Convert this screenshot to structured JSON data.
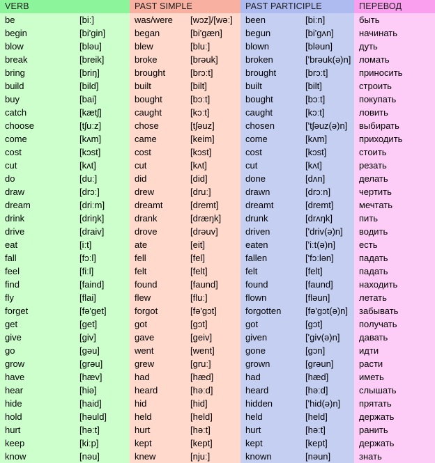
{
  "table": {
    "headers": {
      "verb": "VERB",
      "past_simple": "PAST SIMPLE",
      "past_participle": "PAST PARTICIPLE",
      "translation": "ПЕРЕВОД"
    },
    "colors": {
      "verb_header_bg": "#8cf59b",
      "past_simple_header_bg": "#f8b0a0",
      "past_participle_header_bg": "#aebbf0",
      "translation_header_bg": "#f99fee",
      "verb_bg": "#ccffcc",
      "past_simple_bg": "#ffd9cc",
      "past_participle_bg": "#c5cff2",
      "translation_bg": "#fdcdf7",
      "text": "#000000"
    },
    "rows": [
      {
        "verb": "be",
        "verb_tr": "[biː]",
        "ps": "was/were",
        "ps_tr": "[wɔz]/[wəː]",
        "pp": "been",
        "pp_tr": "[biːn]",
        "ru": "быть"
      },
      {
        "verb": "begin",
        "verb_tr": "[bi'gin]",
        "ps": "began",
        "ps_tr": "[bi'gæn]",
        "pp": "begun",
        "pp_tr": "[bi'gʌn]",
        "ru": "начинать"
      },
      {
        "verb": "blow",
        "verb_tr": "[bləu]",
        "ps": "blew",
        "ps_tr": "[bluː]",
        "pp": "blown",
        "pp_tr": "[bləun]",
        "ru": "дуть"
      },
      {
        "verb": "break",
        "verb_tr": "[breik]",
        "ps": "broke",
        "ps_tr": "[brəuk]",
        "pp": "broken",
        "pp_tr": "['brəuk(ə)n]",
        "ru": "ломать"
      },
      {
        "verb": "bring",
        "verb_tr": "[briŋ]",
        "ps": "brought",
        "ps_tr": "[brɔːt]",
        "pp": "brought",
        "pp_tr": "[brɔːt]",
        "ru": "приносить"
      },
      {
        "verb": "build",
        "verb_tr": "[bild]",
        "ps": "built",
        "ps_tr": "[bilt]",
        "pp": "built",
        "pp_tr": "[bilt]",
        "ru": "строить"
      },
      {
        "verb": "buy",
        "verb_tr": "[bai]",
        "ps": "bought",
        "ps_tr": "[bɔːt]",
        "pp": "bought",
        "pp_tr": "[bɔːt]",
        "ru": "покупать"
      },
      {
        "verb": "catch",
        "verb_tr": "[kætʃ]",
        "ps": "caught",
        "ps_tr": "[kɔːt]",
        "pp": "caught",
        "pp_tr": "[kɔːt]",
        "ru": "ловить"
      },
      {
        "verb": "choose",
        "verb_tr": "[tʃuːz]",
        "ps": "chose",
        "ps_tr": "[tʃəuz]",
        "pp": "chosen",
        "pp_tr": "['tʃəuz(ə)n]",
        "ru": "выбирать"
      },
      {
        "verb": "come",
        "verb_tr": "[kʌm]",
        "ps": "came",
        "ps_tr": "[keim]",
        "pp": "come",
        "pp_tr": "[kʌm]",
        "ru": "приходить"
      },
      {
        "verb": "cost",
        "verb_tr": "[kɔst]",
        "ps": "cost",
        "ps_tr": "[kɔst]",
        "pp": "cost",
        "pp_tr": "[kɔst]",
        "ru": "стоить"
      },
      {
        "verb": "cut",
        "verb_tr": "[kʌt]",
        "ps": "cut",
        "ps_tr": "[kʌt]",
        "pp": "cut",
        "pp_tr": "[kʌt]",
        "ru": "резать"
      },
      {
        "verb": "do",
        "verb_tr": "[duː]",
        "ps": "did",
        "ps_tr": "[did]",
        "pp": "done",
        "pp_tr": "[dʌn]",
        "ru": "делать"
      },
      {
        "verb": "draw",
        "verb_tr": "[drɔː]",
        "ps": "drew",
        "ps_tr": "[druː]",
        "pp": "drawn",
        "pp_tr": "[drɔːn]",
        "ru": "чертить"
      },
      {
        "verb": "dream",
        "verb_tr": "[driːm]",
        "ps": "dreamt",
        "ps_tr": "[dremt]",
        "pp": "dreamt",
        "pp_tr": "[dremt]",
        "ru": "мечтать"
      },
      {
        "verb": "drink",
        "verb_tr": "[driŋk]",
        "ps": "drank",
        "ps_tr": "[dræŋk]",
        "pp": "drunk",
        "pp_tr": "[drʌŋk]",
        "ru": "пить"
      },
      {
        "verb": "drive",
        "verb_tr": "[draiv]",
        "ps": "drove",
        "ps_tr": "[drəuv]",
        "pp": "driven",
        "pp_tr": "['driv(ə)n]",
        "ru": "водить"
      },
      {
        "verb": "eat",
        "verb_tr": "[iːt]",
        "ps": "ate",
        "ps_tr": "[eit]",
        "pp": "eaten",
        "pp_tr": "['iːt(ə)n]",
        "ru": "есть"
      },
      {
        "verb": "fall",
        "verb_tr": "[fɔːl]",
        "ps": "fell",
        "ps_tr": "[fel]",
        "pp": "fallen",
        "pp_tr": "['fɔːlən]",
        "ru": "падать"
      },
      {
        "verb": "feel",
        "verb_tr": "[fiːl]",
        "ps": "felt",
        "ps_tr": "[felt]",
        "pp": "felt",
        "pp_tr": "[felt]",
        "ru": "падать"
      },
      {
        "verb": "find",
        "verb_tr": "[faind]",
        "ps": "found",
        "ps_tr": "[faund]",
        "pp": "found",
        "pp_tr": "[faund]",
        "ru": "находить"
      },
      {
        "verb": "fly",
        "verb_tr": "[flai]",
        "ps": "flew",
        "ps_tr": "[fluː]",
        "pp": "flown",
        "pp_tr": "[fləun]",
        "ru": "летать"
      },
      {
        "verb": "forget",
        "verb_tr": "[fə'get]",
        "ps": "forgot",
        "ps_tr": "[fə'gɔt]",
        "pp": "forgotten",
        "pp_tr": "[fə'gɔt(ə)n]",
        "ru": "забывать"
      },
      {
        "verb": "get",
        "verb_tr": "[get]",
        "ps": "got",
        "ps_tr": "[gɔt]",
        "pp": "got",
        "pp_tr": "[gɔt]",
        "ru": "получать"
      },
      {
        "verb": "give",
        "verb_tr": "[giv]",
        "ps": "gave",
        "ps_tr": "[geiv]",
        "pp": "given",
        "pp_tr": "['giv(ə)n]",
        "ru": "давать"
      },
      {
        "verb": "go",
        "verb_tr": "[gəu]",
        "ps": "went",
        "ps_tr": "[went]",
        "pp": "gone",
        "pp_tr": "[gɔn]",
        "ru": "идти"
      },
      {
        "verb": "grow",
        "verb_tr": "[grəu]",
        "ps": "grew",
        "ps_tr": "[gruː]",
        "pp": "grown",
        "pp_tr": "[grəun]",
        "ru": "расти"
      },
      {
        "verb": "have",
        "verb_tr": "[hæv]",
        "ps": "had",
        "ps_tr": "[hæd]",
        "pp": "had",
        "pp_tr": "[hæd]",
        "ru": "иметь"
      },
      {
        "verb": "hear",
        "verb_tr": "[hiə]",
        "ps": "heard",
        "ps_tr": "[həːd]",
        "pp": "heard",
        "pp_tr": "[həːd]",
        "ru": "слышать"
      },
      {
        "verb": "hide",
        "verb_tr": "[haid]",
        "ps": "hid",
        "ps_tr": "[hid]",
        "pp": "hidden",
        "pp_tr": "['hid(ə)n]",
        "ru": "прятать"
      },
      {
        "verb": "hold",
        "verb_tr": "[həuld]",
        "ps": "held",
        "ps_tr": "[held]",
        "pp": "held",
        "pp_tr": "[held]",
        "ru": "держать"
      },
      {
        "verb": "hurt",
        "verb_tr": "[həːt]",
        "ps": "hurt",
        "ps_tr": "[həːt]",
        "pp": "hurt",
        "pp_tr": "[həːt]",
        "ru": "ранить"
      },
      {
        "verb": "keep",
        "verb_tr": "[kiːp]",
        "ps": "kept",
        "ps_tr": "[kept]",
        "pp": "kept",
        "pp_tr": "[kept]",
        "ru": "держать"
      },
      {
        "verb": "know",
        "verb_tr": "[nəu]",
        "ps": "knew",
        "ps_tr": "[njuː]",
        "pp": "known",
        "pp_tr": "[nəun]",
        "ru": "знать"
      }
    ]
  }
}
